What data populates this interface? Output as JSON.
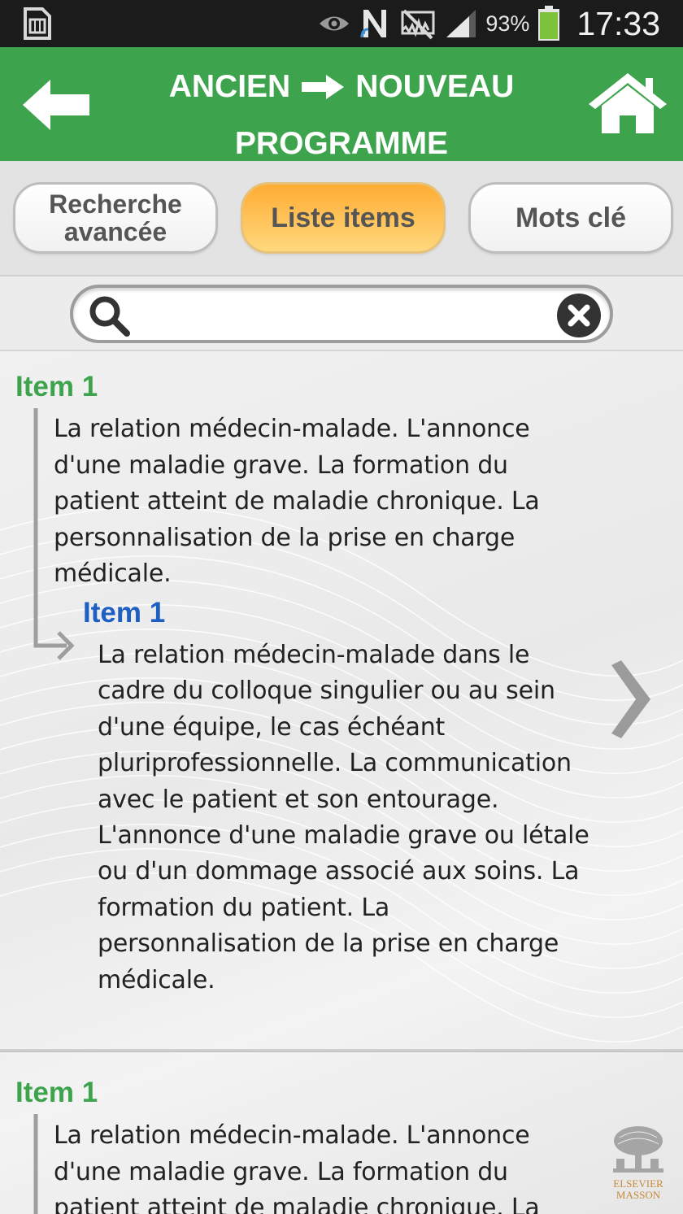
{
  "status_bar": {
    "battery_percent": "93%",
    "time": "17:33",
    "icons": [
      "sim-card-icon",
      "eye-icon",
      "nfc-icon",
      "mute-icon",
      "signal-icon",
      "battery-icon"
    ]
  },
  "header": {
    "title_left": "ANCIEN",
    "title_right": "NOUVEAU",
    "title_line2": "PROGRAMME",
    "colors": {
      "bar": "#3da44d",
      "text": "#ffffff"
    }
  },
  "tabs": {
    "advanced_line1": "Recherche",
    "advanced_line2": "avancée",
    "list": "Liste items",
    "keywords": "Mots clé",
    "active": "list",
    "active_color": "#ffac33"
  },
  "search": {
    "value": "",
    "placeholder": ""
  },
  "entries": [
    {
      "old_label": "Item 1",
      "old_text": "La relation médecin-malade. L'annonce d'une maladie grave. La formation du patient atteint de maladie chronique. La personnalisation de la prise en charge médicale.",
      "new_label": "Item 1",
      "new_text": "La relation médecin-malade dans le cadre du colloque singulier ou au sein d'une équipe, le cas échéant pluriprofessionnelle. La communication avec le patient et son entourage. L'annonce d'une maladie grave ou létale ou d'un dommage associé aux soins. La formation du patient. La personnalisation de la prise en charge médicale."
    },
    {
      "old_label": "Item 1",
      "old_text": "La relation médecin-malade. L'annonce d'une maladie grave. La formation du patient atteint de maladie chronique. La"
    }
  ],
  "publisher": {
    "line1": "ELSEVIER",
    "line2": "MASSON"
  },
  "colors": {
    "old_label": "#3da44d",
    "new_label": "#1d5fc2"
  }
}
